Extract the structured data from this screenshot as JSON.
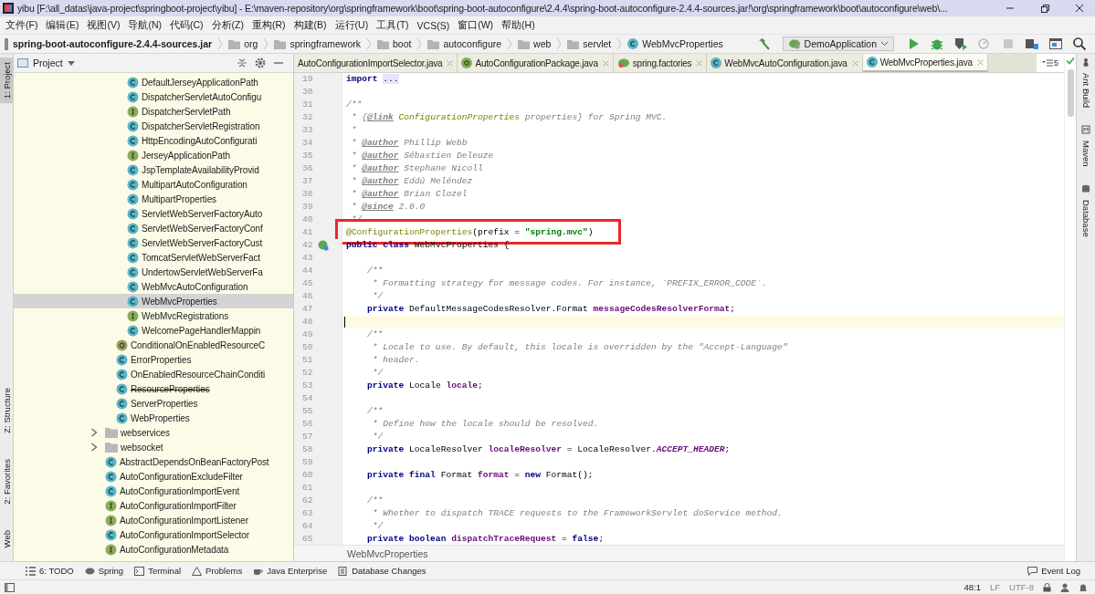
{
  "window": {
    "title": "yibu [F:\\all_datas\\java-project\\springboot-project\\yibu] - E:\\maven-repository\\org\\springframework\\boot\\spring-boot-autoconfigure\\2.4.4\\spring-boot-autoconfigure-2.4.4-sources.jar!\\org\\springframework\\boot\\autoconfigure\\web\\..."
  },
  "menu": [
    "文件(F)",
    "编辑(E)",
    "视图(V)",
    "导航(N)",
    "代码(C)",
    "分析(Z)",
    "重构(R)",
    "构建(B)",
    "运行(U)",
    "工具(T)",
    "VCS(S)",
    "窗口(W)",
    "帮助(H)"
  ],
  "breadcrumb": {
    "jar": "spring-boot-autoconfigure-2.4.4-sources.jar",
    "folders": [
      "org",
      "springframework",
      "boot",
      "autoconfigure",
      "web",
      "servlet"
    ],
    "current": "WebMvcProperties"
  },
  "toolbar": {
    "run_config": "DemoApplication"
  },
  "left_strip": [
    {
      "label": "1: Project",
      "selected": true
    },
    {
      "label": "Z: Structure",
      "selected": false
    },
    {
      "label": "2: Favorites",
      "selected": false
    },
    {
      "label": "Web",
      "selected": false
    }
  ],
  "project_panel": {
    "title": "Project",
    "tree": [
      {
        "children": [
          {
            "children": [
              {
                "label": "DefaultJerseyApplicationPath",
                "kind": "class",
                "selected": false,
                "deprecated": false
              },
              {
                "label": "DispatcherServletAutoConfigu",
                "kind": "class",
                "selected": false,
                "deprecated": false
              },
              {
                "label": "DispatcherServletPath",
                "kind": "interface",
                "selected": false,
                "deprecated": false
              },
              {
                "label": "DispatcherServletRegistration",
                "kind": "class",
                "selected": false,
                "deprecated": false
              },
              {
                "label": "HttpEncodingAutoConfigurati",
                "kind": "class",
                "selected": false,
                "deprecated": false
              },
              {
                "label": "JerseyApplicationPath",
                "kind": "interface",
                "selected": false,
                "deprecated": false
              },
              {
                "label": "JspTemplateAvailabilityProvid",
                "kind": "class",
                "selected": false,
                "deprecated": false
              },
              {
                "label": "MultipartAutoConfiguration",
                "kind": "class",
                "selected": false,
                "deprecated": false
              },
              {
                "label": "MultipartProperties",
                "kind": "class",
                "selected": false,
                "deprecated": false
              },
              {
                "label": "ServletWebServerFactoryAuto",
                "kind": "class",
                "selected": false,
                "deprecated": false
              },
              {
                "label": "ServletWebServerFactoryConf",
                "kind": "class",
                "selected": false,
                "deprecated": false
              },
              {
                "label": "ServletWebServerFactoryCust",
                "kind": "class",
                "selected": false,
                "deprecated": false
              },
              {
                "label": "TomcatServletWebServerFact",
                "kind": "class",
                "selected": false,
                "deprecated": false
              },
              {
                "label": "UndertowServletWebServerFa",
                "kind": "class",
                "selected": false,
                "deprecated": false
              },
              {
                "label": "WebMvcAutoConfiguration",
                "kind": "class",
                "selected": false,
                "deprecated": false
              },
              {
                "label": "WebMvcProperties",
                "kind": "class",
                "selected": true,
                "deprecated": false
              },
              {
                "label": "WebMvcRegistrations",
                "kind": "interface",
                "selected": false,
                "deprecated": false
              },
              {
                "label": "WelcomePageHandlerMappin",
                "kind": "class",
                "selected": false,
                "deprecated": false
              }
            ]
          },
          {
            "label": "ConditionalOnEnabledResourceC",
            "kind": "annotation",
            "selected": false,
            "deprecated": false
          },
          {
            "label": "ErrorProperties",
            "kind": "class",
            "selected": false,
            "deprecated": false
          },
          {
            "label": "OnEnabledResourceChainConditi",
            "kind": "class",
            "selected": false,
            "deprecated": false
          },
          {
            "label": "ResourceProperties",
            "kind": "class",
            "selected": false,
            "deprecated": true
          },
          {
            "label": "ServerProperties",
            "kind": "class",
            "selected": false,
            "deprecated": false
          },
          {
            "label": "WebProperties",
            "kind": "class",
            "selected": false,
            "deprecated": false
          }
        ]
      },
      {
        "label": "webservices",
        "kind": "folder",
        "selected": false,
        "expanded": false
      },
      {
        "label": "websocket",
        "kind": "folder",
        "selected": false,
        "expanded": false
      },
      {
        "label": "AbstractDependsOnBeanFactoryPost",
        "kind": "class",
        "selected": false,
        "deprecated": false
      },
      {
        "label": "AutoConfigurationExcludeFilter",
        "kind": "class",
        "selected": false,
        "deprecated": false
      },
      {
        "label": "AutoConfigurationImportEvent",
        "kind": "class",
        "selected": false,
        "deprecated": false
      },
      {
        "label": "AutoConfigurationImportFilter",
        "kind": "interface",
        "selected": false,
        "deprecated": false
      },
      {
        "label": "AutoConfigurationImportListener",
        "kind": "interface",
        "selected": false,
        "deprecated": false
      },
      {
        "label": "AutoConfigurationImportSelector",
        "kind": "class",
        "selected": false,
        "deprecated": false
      },
      {
        "label": "AutoConfigurationMetadata",
        "kind": "interface",
        "selected": false,
        "deprecated": false
      }
    ]
  },
  "tabs": [
    {
      "label": "AutoConfigurationImportSelector.java",
      "kind": "plain",
      "selected": false
    },
    {
      "label": "AutoConfigurationPackage.java",
      "kind": "annotation",
      "selected": false
    },
    {
      "label": "spring.factories",
      "kind": "spring",
      "selected": false
    },
    {
      "label": "WebMvcAutoConfiguration.java",
      "kind": "class",
      "selected": false
    },
    {
      "label": "WebMvcProperties.java",
      "kind": "class",
      "selected": true
    }
  ],
  "tab_overflow": "5",
  "editor": {
    "footer": "WebMvcProperties",
    "lines": [
      {
        "n": "19",
        "tokens": [
          {
            "kind": "kw",
            "text": "import "
          },
          {
            "kind": "fold",
            "text": "..."
          }
        ]
      },
      {
        "n": "30"
      },
      {
        "n": "31",
        "tokens": [
          {
            "kind": "cm",
            "text": "/**"
          }
        ]
      },
      {
        "n": "32",
        "tokens": [
          {
            "kind": "cm",
            "text": " * {"
          },
          {
            "kind": "tag",
            "text": "@link"
          },
          {
            "kind": "ref",
            "text": " ConfigurationProperties"
          },
          {
            "kind": "cm",
            "text": " properties} for Spring MVC."
          }
        ]
      },
      {
        "n": "33",
        "tokens": [
          {
            "kind": "cm",
            "text": " *"
          }
        ]
      },
      {
        "n": "34",
        "tokens": [
          {
            "kind": "cm",
            "text": " * "
          },
          {
            "kind": "tag",
            "text": "@author"
          },
          {
            "kind": "cm",
            "text": " Phillip Webb"
          }
        ]
      },
      {
        "n": "35",
        "tokens": [
          {
            "kind": "cm",
            "text": " * "
          },
          {
            "kind": "tag",
            "text": "@author"
          },
          {
            "kind": "cm",
            "text": " Sébastien Deleuze"
          }
        ]
      },
      {
        "n": "36",
        "tokens": [
          {
            "kind": "cm",
            "text": " * "
          },
          {
            "kind": "tag",
            "text": "@author"
          },
          {
            "kind": "cm",
            "text": " Stephane Nicoll"
          }
        ]
      },
      {
        "n": "37",
        "tokens": [
          {
            "kind": "cm",
            "text": " * "
          },
          {
            "kind": "tag",
            "text": "@author"
          },
          {
            "kind": "cm",
            "text": " Eddú Meléndez"
          }
        ]
      },
      {
        "n": "38",
        "tokens": [
          {
            "kind": "cm",
            "text": " * "
          },
          {
            "kind": "tag",
            "text": "@author"
          },
          {
            "kind": "cm",
            "text": " Brian Clozel"
          }
        ]
      },
      {
        "n": "39",
        "tokens": [
          {
            "kind": "cm",
            "text": " * "
          },
          {
            "kind": "tag",
            "text": "@since"
          },
          {
            "kind": "cm",
            "text": " 2.0.0"
          }
        ]
      },
      {
        "n": "40",
        "tokens": [
          {
            "kind": "cm",
            "text": " */"
          }
        ]
      },
      {
        "n": "41",
        "boxed": true,
        "tokens": [
          {
            "kind": "ann",
            "text": "@ConfigurationProperties"
          },
          {
            "kind": "p",
            "text": "(prefix = "
          },
          {
            "kind": "str",
            "text": "\"spring.mvc\""
          },
          {
            "kind": "p",
            "text": ")"
          }
        ]
      },
      {
        "n": "42",
        "gutter_icon": true,
        "tokens": [
          {
            "kind": "kw",
            "text": "public class"
          },
          {
            "kind": "p",
            "text": " WebMvcProperties {"
          }
        ]
      },
      {
        "n": "43"
      },
      {
        "n": "44",
        "tokens": [
          {
            "kind": "cm",
            "text": "    /**"
          }
        ]
      },
      {
        "n": "45",
        "tokens": [
          {
            "kind": "cm",
            "text": "     * Formatting strategy for message codes. For instance, `PREFIX_ERROR_CODE`."
          }
        ]
      },
      {
        "n": "46",
        "tokens": [
          {
            "kind": "cm",
            "text": "     */"
          }
        ]
      },
      {
        "n": "47",
        "tokens": [
          {
            "kind": "kw",
            "text": "    private"
          },
          {
            "kind": "p",
            "text": " DefaultMessageCodesResolver.Format "
          },
          {
            "kind": "fld",
            "text": "messageCodesResolverFormat"
          },
          {
            "kind": "p",
            "text": ";"
          }
        ]
      },
      {
        "n": "48",
        "current": true
      },
      {
        "n": "49",
        "tokens": [
          {
            "kind": "cm",
            "text": "    /**"
          }
        ]
      },
      {
        "n": "50",
        "tokens": [
          {
            "kind": "cm",
            "text": "     * Locale to use. By default, this locale is overridden by the \"Accept-Language\""
          }
        ]
      },
      {
        "n": "51",
        "tokens": [
          {
            "kind": "cm",
            "text": "     * header."
          }
        ]
      },
      {
        "n": "52",
        "tokens": [
          {
            "kind": "cm",
            "text": "     */"
          }
        ]
      },
      {
        "n": "53",
        "tokens": [
          {
            "kind": "kw",
            "text": "    private"
          },
          {
            "kind": "p",
            "text": " Locale "
          },
          {
            "kind": "fld",
            "text": "locale"
          },
          {
            "kind": "p",
            "text": ";"
          }
        ]
      },
      {
        "n": "54"
      },
      {
        "n": "55",
        "tokens": [
          {
            "kind": "cm",
            "text": "    /**"
          }
        ]
      },
      {
        "n": "56",
        "tokens": [
          {
            "kind": "cm",
            "text": "     * Define how the locale should be resolved."
          }
        ]
      },
      {
        "n": "57",
        "tokens": [
          {
            "kind": "cm",
            "text": "     */"
          }
        ]
      },
      {
        "n": "58",
        "tokens": [
          {
            "kind": "kw",
            "text": "    private"
          },
          {
            "kind": "p",
            "text": " LocaleResolver "
          },
          {
            "kind": "fld",
            "text": "localeResolver"
          },
          {
            "kind": "p",
            "text": " = LocaleResolver."
          },
          {
            "kind": "cst",
            "text": "ACCEPT_HEADER"
          },
          {
            "kind": "p",
            "text": ";"
          }
        ]
      },
      {
        "n": "59"
      },
      {
        "n": "60",
        "tokens": [
          {
            "kind": "kw",
            "text": "    private final"
          },
          {
            "kind": "p",
            "text": " Format "
          },
          {
            "kind": "fld",
            "text": "format"
          },
          {
            "kind": "p",
            "text": " = "
          },
          {
            "kind": "kw",
            "text": "new"
          },
          {
            "kind": "p",
            "text": " Format();"
          }
        ]
      },
      {
        "n": "61"
      },
      {
        "n": "62",
        "tokens": [
          {
            "kind": "cm",
            "text": "    /**"
          }
        ]
      },
      {
        "n": "63",
        "tokens": [
          {
            "kind": "cm",
            "text": "     * Whether to dispatch TRACE requests to the FrameworkServlet doService method."
          }
        ]
      },
      {
        "n": "64",
        "tokens": [
          {
            "kind": "cm",
            "text": "     */"
          }
        ]
      },
      {
        "n": "65",
        "tokens": [
          {
            "kind": "kw",
            "text": "    private boolean"
          },
          {
            "kind": "fld",
            "text": " dispatchTraceRequest"
          },
          {
            "kind": "p",
            "text": " = "
          },
          {
            "kind": "kw",
            "text": "false"
          },
          {
            "kind": "p",
            "text": ";"
          }
        ]
      }
    ]
  },
  "right_strip": [
    {
      "label": "Ant Build",
      "kind": "ant"
    },
    {
      "label": "Maven",
      "kind": "maven"
    },
    {
      "label": "Database",
      "kind": "database"
    }
  ],
  "tool_tabs": [
    {
      "label": "6: TODO",
      "kind": "todo"
    },
    {
      "label": "Spring",
      "kind": "spring"
    },
    {
      "label": "Terminal",
      "kind": "terminal"
    },
    {
      "label": "Problems",
      "kind": "problems"
    },
    {
      "label": "Java Enterprise",
      "kind": "enterprise"
    },
    {
      "label": "Database Changes",
      "kind": "database"
    },
    {
      "label": "Event Log",
      "kind": "log"
    }
  ],
  "status": {
    "position": "48:1",
    "line_separator": "LF",
    "encoding": "UTF-8"
  }
}
